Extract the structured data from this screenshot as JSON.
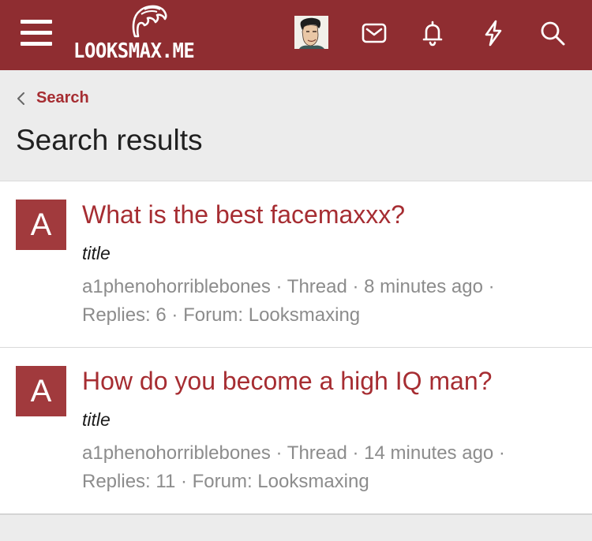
{
  "app": {
    "logo_text": "LOOKSMAX.ME",
    "brand_color": "#8f2d31",
    "link_color": "#a62d32"
  },
  "topbar": {
    "icons": [
      "menu-icon",
      "mail-icon",
      "bell-icon",
      "bolt-icon",
      "search-icon"
    ]
  },
  "breadcrumb": {
    "label": "Search"
  },
  "page": {
    "title": "Search results"
  },
  "results": [
    {
      "avatar_letter": "A",
      "title": "What is the best facemaxxx?",
      "snippet": "title",
      "author": "a1phenohorriblebones",
      "type": "Thread",
      "time": "8 minutes ago",
      "replies": "Replies: 6",
      "forum": "Forum: Looksmaxing"
    },
    {
      "avatar_letter": "A",
      "title": "How do you become a high IQ man?",
      "snippet": "title",
      "author": "a1phenohorriblebones",
      "type": "Thread",
      "time": "14 minutes ago",
      "replies": "Replies: 11",
      "forum": "Forum: Looksmaxing"
    }
  ]
}
